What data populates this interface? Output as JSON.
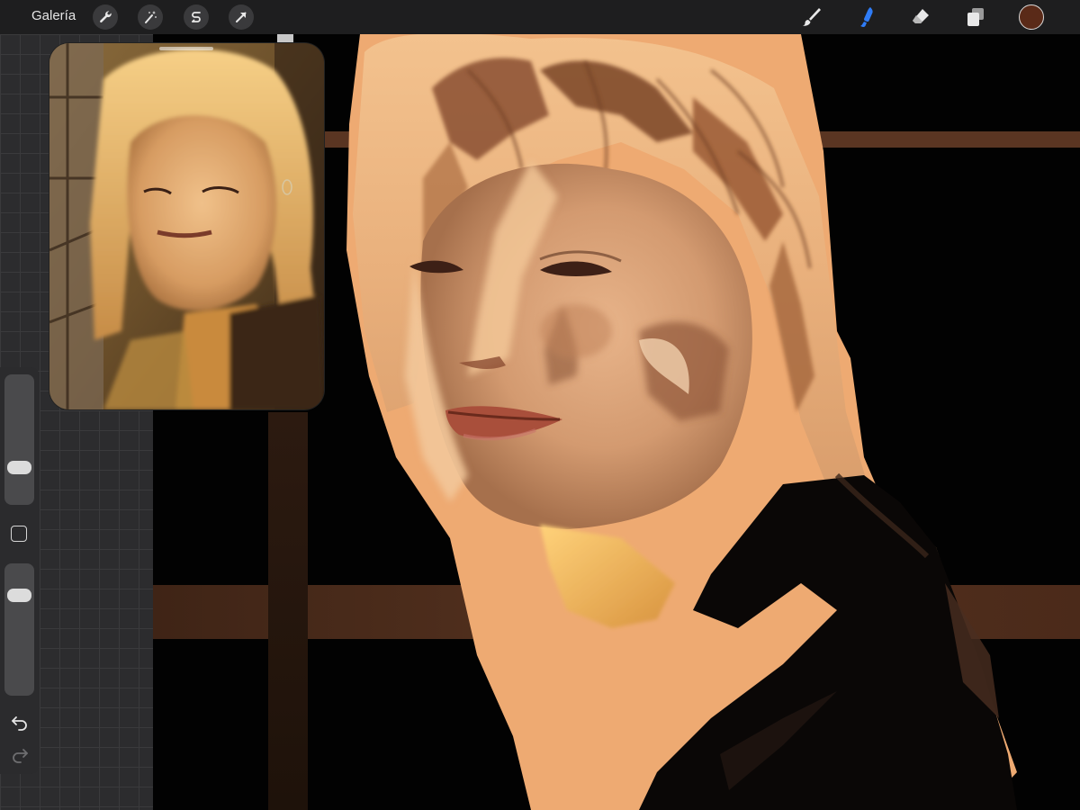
{
  "app": {
    "gallery_label": "Galería"
  },
  "toolbar": {
    "left_tools": [
      "wrench-icon",
      "magic-wand-icon",
      "selection-icon",
      "transform-arrow-icon"
    ],
    "right_tools": [
      "brush-icon",
      "smudge-icon",
      "eraser-icon",
      "layers-icon"
    ],
    "active_tool": "smudge-icon",
    "active_color": "#5a2a18",
    "accent_color": "#2f7cf6"
  },
  "sidebar": {
    "brush_size_level": 0.25,
    "opacity_level": 0.8,
    "icons": [
      "modify-square-icon",
      "undo-icon",
      "redo-icon"
    ]
  }
}
